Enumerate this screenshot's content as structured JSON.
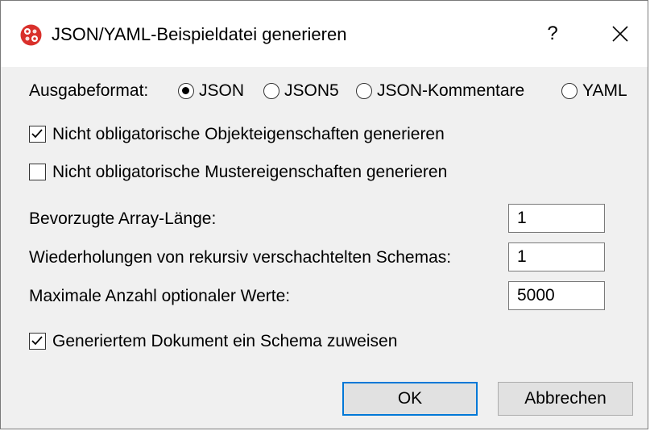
{
  "dialog": {
    "title": "JSON/YAML-Beispieldatei generieren",
    "help_label": "?",
    "close_icon": "close-icon",
    "app_icon": "altova-icon",
    "accent_color": "#0078d7"
  },
  "output_format": {
    "label": "Ausgabeformat:",
    "options": [
      "JSON",
      "JSON5",
      "JSON-Kommentare",
      "YAML"
    ],
    "selected": "JSON"
  },
  "checkboxes": {
    "optional_object_props": {
      "label": "Nicht obligatorische Objekteigenschaften generieren",
      "checked": true
    },
    "optional_pattern_props": {
      "label": "Nicht obligatorische Mustereigenschaften generieren",
      "checked": false
    },
    "assign_schema": {
      "label": "Generiertem Dokument ein Schema zuweisen",
      "checked": true
    }
  },
  "fields": {
    "array_length": {
      "label": "Bevorzugte Array-Länge:",
      "value": "1"
    },
    "recursion": {
      "label": "Wiederholungen von rekursiv verschachtelten Schemas:",
      "value": "1"
    },
    "max_optional": {
      "label": "Maximale Anzahl optionaler Werte:",
      "value": "5000"
    }
  },
  "buttons": {
    "ok": "OK",
    "cancel": "Abbrechen"
  }
}
